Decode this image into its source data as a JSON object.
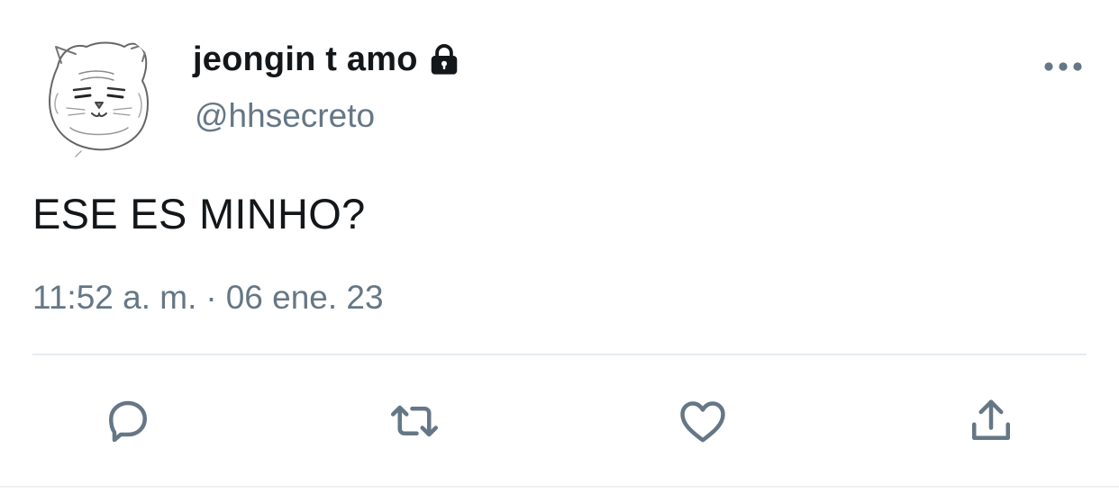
{
  "tweet": {
    "display_name": "jeongin t amo",
    "handle": "@hhsecreto",
    "text": "ESE ES MINHO?",
    "time": "11:52 a. m.",
    "separator": "·",
    "date": "06 ene. 23",
    "protected": true
  },
  "icons": {
    "avatar": "cartoon-cat-face-avatar",
    "lock": "lock-icon",
    "more": "more-options-icon",
    "reply": "reply-icon",
    "retweet": "retweet-icon",
    "like": "heart-icon",
    "share": "share-icon"
  },
  "colors": {
    "text_primary": "#14171a",
    "text_secondary": "#657786",
    "divider": "#e6ecf0",
    "background": "#ffffff"
  }
}
